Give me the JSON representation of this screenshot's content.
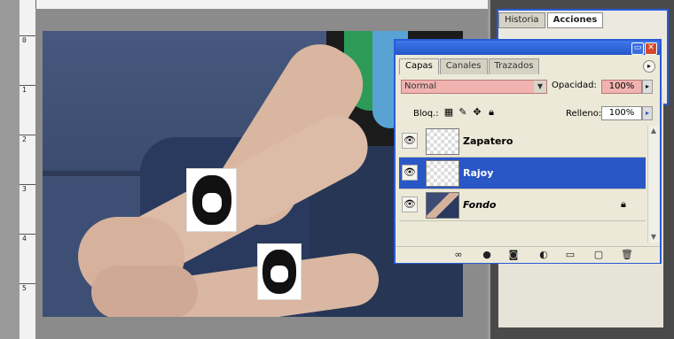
{
  "ruler": {
    "marks": [
      "0",
      "1",
      "2",
      "3",
      "4",
      "5"
    ]
  },
  "background_panel": {
    "tabs": [
      {
        "label": "Historia"
      },
      {
        "label": "Acciones"
      }
    ]
  },
  "layers_panel": {
    "tabs": [
      {
        "label": "Capas"
      },
      {
        "label": "Canales"
      },
      {
        "label": "Trazados"
      }
    ],
    "blend_mode": "Normal",
    "opacity_label": "Opacidad:",
    "opacity_value": "100%",
    "lock_label": "Bloq.:",
    "fill_label": "Relleno:",
    "fill_value": "100%",
    "layers": [
      {
        "name": "Zapatero",
        "selected": false
      },
      {
        "name": "Rajoy",
        "selected": true
      },
      {
        "name": "Fondo",
        "selected": false,
        "locked": true
      }
    ]
  },
  "colors": {
    "selection": "#2a57c6",
    "title_bar": "#2456c9",
    "highlight": "#f1b3b0"
  }
}
